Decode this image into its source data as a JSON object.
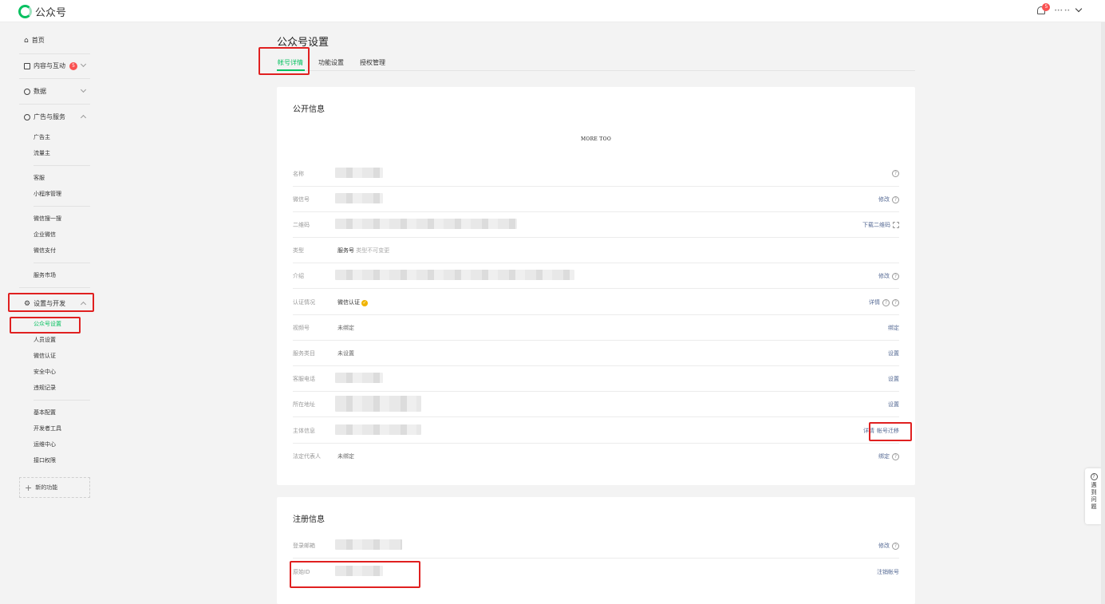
{
  "app": {
    "title": "公众号"
  },
  "header": {
    "notification_count": "5",
    "user_name": "••• ••"
  },
  "sidebar": {
    "home": "首页",
    "content": "内容与互动",
    "content_badge": "5",
    "data": "数据",
    "ads": "广告与服务",
    "ads_items": [
      "广告主",
      "流量主"
    ],
    "service_items": [
      "客服",
      "小程序管理"
    ],
    "wechat_items": [
      "微信搜一搜",
      "企业微信",
      "微信支付"
    ],
    "market": "服务市场",
    "settings": "设置与开发",
    "settings_items": [
      "公众号设置",
      "人员设置",
      "微信认证",
      "安全中心",
      "违规记录"
    ],
    "dev_items": [
      "基本配置",
      "开发者工具",
      "运维中心",
      "接口权限"
    ],
    "new_feature": "新的功能"
  },
  "main": {
    "title": "公众号设置",
    "tabs": [
      "帐号详情",
      "功能设置",
      "授权管理"
    ],
    "public_info": {
      "title": "公开信息",
      "avatar_text": "MORE TOO",
      "rows": [
        {
          "label": "名称",
          "value": "",
          "action": ""
        },
        {
          "label": "微信号",
          "value": "",
          "action": "修改"
        },
        {
          "label": "二维码",
          "value": "",
          "action": "下载二维码"
        },
        {
          "label": "类型",
          "value": "服务号",
          "value_note": "类型不可变更",
          "action": ""
        },
        {
          "label": "介绍",
          "value": "",
          "action": "修改"
        },
        {
          "label": "认证情况",
          "value": "微信认证",
          "action": "详情"
        },
        {
          "label": "视频号",
          "value": "未绑定",
          "action": "绑定"
        },
        {
          "label": "服务类目",
          "value": "未设置",
          "action": "设置"
        },
        {
          "label": "客服电话",
          "value": "",
          "action": "设置"
        },
        {
          "label": "所在地址",
          "value": "",
          "action": "设置"
        },
        {
          "label": "主体信息",
          "value": "",
          "action": "详情",
          "action2": "帐号迁移"
        },
        {
          "label": "法定代表人",
          "value": "未绑定",
          "action": "绑定"
        }
      ]
    },
    "register_info": {
      "title": "注册信息",
      "rows": [
        {
          "label": "登录邮箱",
          "value": "",
          "action": "修改"
        },
        {
          "label": "原始ID",
          "value": "",
          "action": "注销帐号"
        }
      ]
    }
  },
  "help": {
    "label": "遇到问题"
  },
  "colors": {
    "accent": "#07c160",
    "link": "#576b95",
    "highlight": "#e02020",
    "badge": "#fa5151"
  }
}
